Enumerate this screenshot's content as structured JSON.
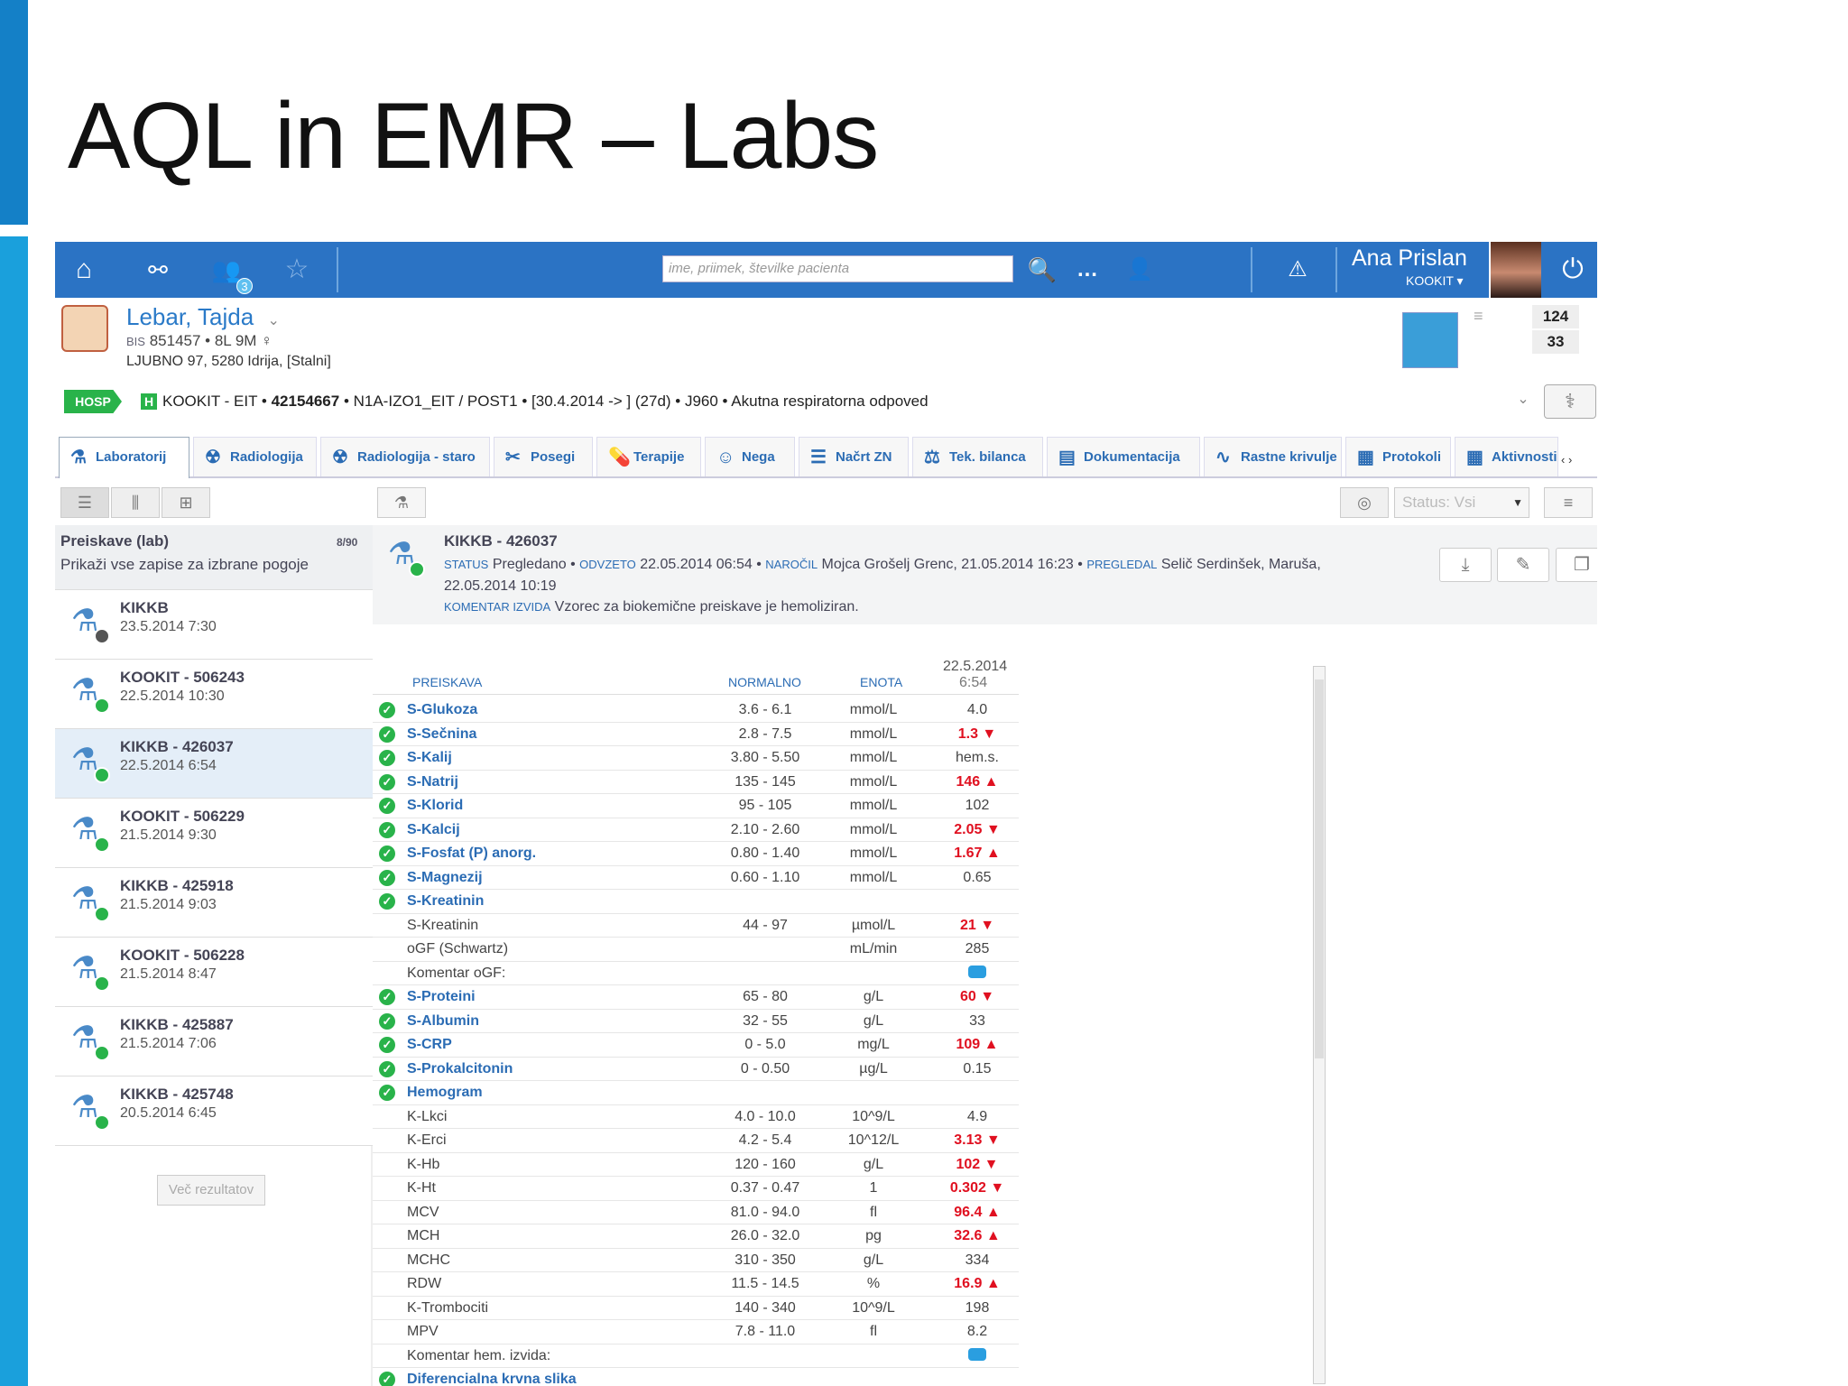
{
  "slide": {
    "title": "AQL in EMR – Labs"
  },
  "topbar": {
    "badge": "3",
    "search_placeholder": "ime, priimek, številke pacienta",
    "user_name": "Ana Prislan",
    "user_role": "KOOKIT ▾",
    "colors": {
      "bar": "#2b73c4"
    }
  },
  "patient": {
    "name": "Lebar, Tajda",
    "name_caret": "⌄",
    "id_label": "BIS",
    "id_line": "851457  •  8L 9M ♀",
    "address": "LJUBNO 97, 5280 Idrija, [Stalni]",
    "count_a": "124",
    "count_b": "33"
  },
  "encounter": {
    "badge": "HOSP",
    "text_a": "KOOKIT - EIT  • ",
    "text_b": "42154667",
    "text_c": "  •  N1A-IZO1_EIT / POST1  •  [30.4.2014 -> ] (27d)  •  J960  •  Akutna respiratorna odpoved",
    "h_icon": "H"
  },
  "tabs": [
    {
      "label": "Laboratorij",
      "icon": "flask-icon"
    },
    {
      "label": "Radiologija",
      "icon": "xray-icon"
    },
    {
      "label": "Radiologija - staro",
      "icon": "xray-icon"
    },
    {
      "label": "Posegi",
      "icon": "scalpel-icon"
    },
    {
      "label": "Terapije",
      "icon": "pill-icon"
    },
    {
      "label": "Nega",
      "icon": "nurse-icon"
    },
    {
      "label": "Načrt ZN",
      "icon": "plan-icon"
    },
    {
      "label": "Tek. bilanca",
      "icon": "balance-icon"
    },
    {
      "label": "Dokumentacija",
      "icon": "box-icon"
    },
    {
      "label": "Rastne krivulje",
      "icon": "curve-icon"
    },
    {
      "label": "Protokoli",
      "icon": "doc-icon"
    },
    {
      "label": "Aktivnosti",
      "icon": "grid-icon"
    }
  ],
  "toolbar": {
    "status_label": "Status: Vsi"
  },
  "left_panel": {
    "title": "Preiskave (lab)",
    "count": "8/90",
    "subtitle": "Prikaži vse zapise za izbrane pogoje",
    "items": [
      {
        "title": "KIKKB",
        "date": "23.5.2014 7:30"
      },
      {
        "title": "KOOKIT - 506243",
        "date": "22.5.2014 10:30"
      },
      {
        "title": "KIKKB - 426037",
        "date": "22.5.2014 6:54"
      },
      {
        "title": "KOOKIT - 506229",
        "date": "21.5.2014 9:30"
      },
      {
        "title": "KIKKB - 425918",
        "date": "21.5.2014 9:03"
      },
      {
        "title": "KOOKIT - 506228",
        "date": "21.5.2014 8:47"
      },
      {
        "title": "KIKKB - 425887",
        "date": "21.5.2014 7:06"
      },
      {
        "title": "KIKKB - 425748",
        "date": "20.5.2014 6:45"
      }
    ],
    "more_label": "Več rezultatov"
  },
  "detail": {
    "title": "KIKKB - 426037",
    "status_label": "STATUS",
    "status_value": "Pregledano",
    "taken_label": "ODVZETO",
    "taken_value": "22.05.2014 06:54",
    "ordered_label": "NAROČIL",
    "ordered_value": "Mojca Grošelj Grenc, 21.05.2014 16:23",
    "reviewed_label": "PREGLEDAL",
    "reviewed_value": "Selič Serdinšek, Maruša, 22.05.2014 10:19",
    "comment_label": "KOMENTAR IZVIDA",
    "comment_value": "Vzorec za biokemične preiskave je hemoliziran."
  },
  "results": {
    "headers": {
      "test": "PREISKAVA",
      "normal": "NORMALNO",
      "unit": "ENOTA",
      "date_a": "22.5.2014",
      "date_b": "6:54"
    },
    "rows": [
      {
        "name": "S-Glukoza",
        "group": true,
        "normal": "3.6 - 6.1",
        "unit": "mmol/L",
        "value": "4.0",
        "flag": ""
      },
      {
        "name": "S-Sečnina",
        "group": true,
        "normal": "2.8 - 7.5",
        "unit": "mmol/L",
        "value": "1.3 ▼",
        "flag": "lo"
      },
      {
        "name": "S-Kalij",
        "group": true,
        "normal": "3.80 - 5.50",
        "unit": "mmol/L",
        "value": "hem.s.",
        "flag": ""
      },
      {
        "name": "S-Natrij",
        "group": true,
        "normal": "135 - 145",
        "unit": "mmol/L",
        "value": "146 ▲",
        "flag": "hi"
      },
      {
        "name": "S-Klorid",
        "group": true,
        "normal": "95 - 105",
        "unit": "mmol/L",
        "value": "102",
        "flag": ""
      },
      {
        "name": "S-Kalcij",
        "group": true,
        "normal": "2.10 - 2.60",
        "unit": "mmol/L",
        "value": "2.05 ▼",
        "flag": "lo"
      },
      {
        "name": "S-Fosfat (P) anorg.",
        "group": true,
        "normal": "0.80 - 1.40",
        "unit": "mmol/L",
        "value": "1.67 ▲",
        "flag": "hi"
      },
      {
        "name": "S-Magnezij",
        "group": true,
        "normal": "0.60 - 1.10",
        "unit": "mmol/L",
        "value": "0.65",
        "flag": ""
      },
      {
        "name": "S-Kreatinin",
        "group": true,
        "normal": "",
        "unit": "",
        "value": "",
        "flag": ""
      },
      {
        "name": "S-Kreatinin",
        "group": false,
        "normal": "44 - 97",
        "unit": "µmol/L",
        "value": "21 ▼",
        "flag": "lo"
      },
      {
        "name": "oGF (Schwartz)",
        "group": false,
        "normal": "",
        "unit": "mL/min",
        "value": "285",
        "flag": ""
      },
      {
        "name": "Komentar oGF:",
        "group": false,
        "normal": "",
        "unit": "",
        "value": "",
        "flag": "comment"
      },
      {
        "name": "S-Proteini",
        "group": true,
        "normal": "65 - 80",
        "unit": "g/L",
        "value": "60 ▼",
        "flag": "lo"
      },
      {
        "name": "S-Albumin",
        "group": true,
        "normal": "32 - 55",
        "unit": "g/L",
        "value": "33",
        "flag": ""
      },
      {
        "name": "S-CRP",
        "group": true,
        "normal": "0 - 5.0",
        "unit": "mg/L",
        "value": "109 ▲",
        "flag": "hi"
      },
      {
        "name": "S-Prokalcitonin",
        "group": true,
        "normal": "0 - 0.50",
        "unit": "µg/L",
        "value": "0.15",
        "flag": ""
      },
      {
        "name": "Hemogram",
        "group": true,
        "normal": "",
        "unit": "",
        "value": "",
        "flag": ""
      },
      {
        "name": "K-Lkci",
        "group": false,
        "normal": "4.0 - 10.0",
        "unit": "10^9/L",
        "value": "4.9",
        "flag": ""
      },
      {
        "name": "K-Erci",
        "group": false,
        "normal": "4.2 - 5.4",
        "unit": "10^12/L",
        "value": "3.13 ▼",
        "flag": "lo"
      },
      {
        "name": "K-Hb",
        "group": false,
        "normal": "120 - 160",
        "unit": "g/L",
        "value": "102 ▼",
        "flag": "lo"
      },
      {
        "name": "K-Ht",
        "group": false,
        "normal": "0.37 - 0.47",
        "unit": "1",
        "value": "0.302 ▼",
        "flag": "lo"
      },
      {
        "name": "MCV",
        "group": false,
        "normal": "81.0 - 94.0",
        "unit": "fl",
        "value": "96.4 ▲",
        "flag": "hi"
      },
      {
        "name": "MCH",
        "group": false,
        "normal": "26.0 - 32.0",
        "unit": "pg",
        "value": "32.6 ▲",
        "flag": "hi"
      },
      {
        "name": "MCHC",
        "group": false,
        "normal": "310 - 350",
        "unit": "g/L",
        "value": "334",
        "flag": ""
      },
      {
        "name": "RDW",
        "group": false,
        "normal": "11.5 - 14.5",
        "unit": "%",
        "value": "16.9 ▲",
        "flag": "hi"
      },
      {
        "name": "K-Trombociti",
        "group": false,
        "normal": "140 - 340",
        "unit": "10^9/L",
        "value": "198",
        "flag": ""
      },
      {
        "name": "MPV",
        "group": false,
        "normal": "7.8 - 11.0",
        "unit": "fl",
        "value": "8.2",
        "flag": ""
      },
      {
        "name": "Komentar hem. izvida:",
        "group": false,
        "normal": "",
        "unit": "",
        "value": "",
        "flag": "comment"
      },
      {
        "name": "Diferencialna krvna slika",
        "group": true,
        "normal": "",
        "unit": "",
        "value": "",
        "flag": ""
      }
    ]
  },
  "colors": {
    "accent_dark": "#1480c7",
    "accent_light": "#1aa0dc",
    "ok_green": "#29b34a",
    "alert_red": "#e01020",
    "link_blue": "#2b6cb4"
  }
}
